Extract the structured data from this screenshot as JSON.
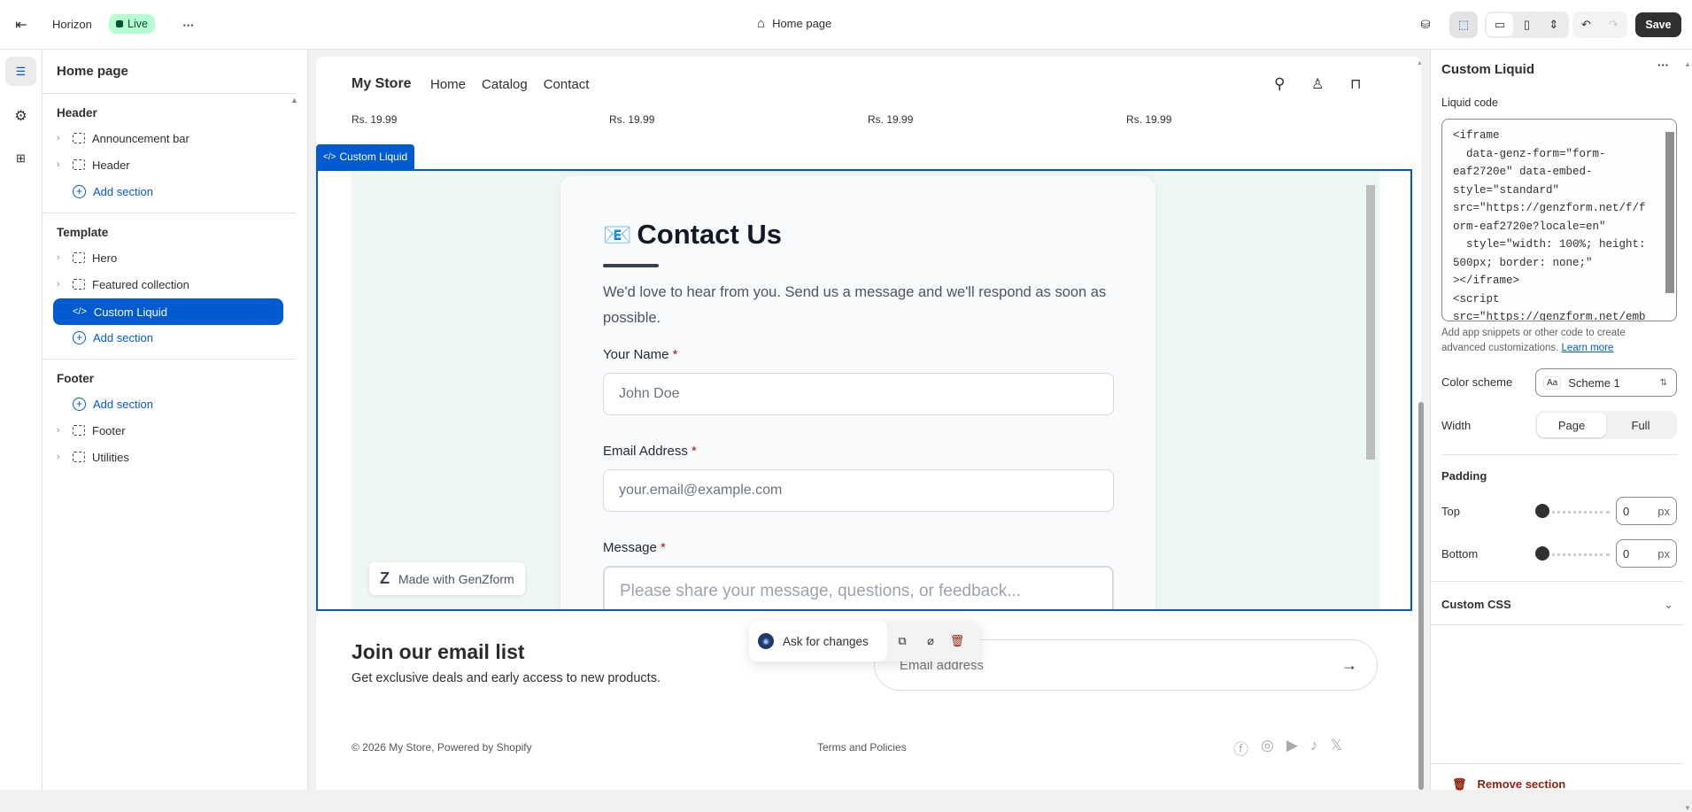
{
  "topbar": {
    "theme_name": "Horizon",
    "status": "Live",
    "page_title": "Home page",
    "save_label": "Save"
  },
  "sidebar": {
    "title": "Home page",
    "groups": [
      {
        "label": "Header",
        "items": [
          "Announcement bar",
          "Header"
        ],
        "add": "Add section"
      },
      {
        "label": "Template",
        "items": [
          "Hero",
          "Featured collection",
          "Custom Liquid"
        ],
        "add": "Add section"
      },
      {
        "label": "Footer",
        "items": [
          "Footer",
          "Utilities"
        ],
        "add": "Add section"
      }
    ]
  },
  "preview": {
    "store_name": "My Store",
    "nav": [
      "Home",
      "Catalog",
      "Contact"
    ],
    "prices": [
      "Rs. 19.99",
      "Rs. 19.99",
      "Rs. 19.99",
      "Rs. 19.99"
    ],
    "section_tag": "Custom Liquid",
    "form": {
      "emoji": "📧",
      "title": "Contact Us",
      "description": "We'd love to hear from you. Send us a message and we'll respond as soon as possible.",
      "name_label": "Your Name",
      "name_placeholder": "John Doe",
      "email_label": "Email Address",
      "email_placeholder": "your.email@example.com",
      "message_label": "Message",
      "message_placeholder": "Please share your message, questions, or feedback...",
      "required_mark": "*",
      "badge": "Made with GenZform",
      "badge_logo": "Z"
    },
    "newsletter": {
      "title": "Join our email list",
      "subtitle": "Get exclusive deals and early access to new products.",
      "placeholder": "Email address"
    },
    "footer": {
      "copyright": "© 2026 My Store, Powered by Shopify",
      "links": "Terms and Policies",
      "social": [
        "facebook-icon",
        "instagram-icon",
        "youtube-icon",
        "tiktok-icon",
        "x-icon"
      ]
    },
    "toolbar": {
      "ask_label": "Ask for changes"
    }
  },
  "settings": {
    "title": "Custom Liquid",
    "code_label": "Liquid code",
    "code": "<iframe\n  data-genz-form=\"form-\neaf2720e\" data-embed-\nstyle=\"standard\"\nsrc=\"https://genzform.net/f/f\norm-eaf2720e?locale=en\"\n  style=\"width: 100%; height:\n500px; border: none;\"\n></iframe>\n<script\nsrc=\"https://genzform.net/emb",
    "help": "Add app snippets or other code to create advanced customizations.",
    "learn_more": "Learn more",
    "color_scheme_label": "Color scheme",
    "color_scheme_value": "Scheme 1",
    "color_scheme_icon_text": "Aa",
    "width_label": "Width",
    "width_options": [
      "Page",
      "Full"
    ],
    "width_selected": "Page",
    "padding_title": "Padding",
    "top_label": "Top",
    "top_value": "0",
    "bottom_label": "Bottom",
    "bottom_value": "0",
    "unit": "px",
    "custom_css": "Custom CSS",
    "remove": "Remove section"
  },
  "colors": {
    "accent": "#005bd3",
    "live_badge": "#b4fed2",
    "danger": "#8e1f0b",
    "form_bg": "#eef7f4"
  }
}
